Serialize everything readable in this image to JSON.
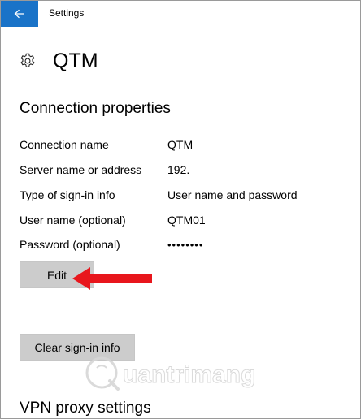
{
  "titlebar": {
    "back_icon": "arrow-left-icon",
    "title": "Settings",
    "accent_color": "#1a73c8"
  },
  "header": {
    "icon": "gear-icon",
    "title": "QTM"
  },
  "connection": {
    "section_title": "Connection properties",
    "rows": [
      {
        "label": "Connection name",
        "value": "QTM"
      },
      {
        "label": "Server name or address",
        "value": "192."
      },
      {
        "label": "Type of sign-in info",
        "value": "User name and password"
      },
      {
        "label": "User name (optional)",
        "value": "QTM01"
      },
      {
        "label": "Password (optional)",
        "value": "••••••••"
      }
    ],
    "edit_label": "Edit",
    "clear_label": "Clear sign-in info"
  },
  "annotation": {
    "arrow_color": "#e8161c"
  },
  "watermark": {
    "text": "uantrimang"
  },
  "vpn": {
    "section_title": "VPN proxy settings"
  }
}
